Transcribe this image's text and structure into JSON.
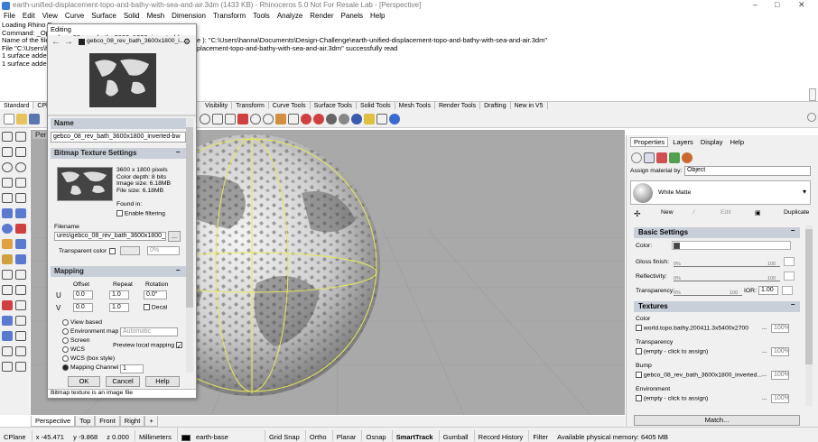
{
  "window": {
    "title": "earth-unified-displacement-topo-and-bathy-with-sea-and-air.3dm (1433 KB) - Rhinoceros 5.0 Not For Resale Lab - [Perspective]",
    "controls": [
      "–",
      "□",
      "✕"
    ]
  },
  "menu": [
    "File",
    "Edit",
    "View",
    "Curve",
    "Surface",
    "Solid",
    "Mesh",
    "Dimension",
    "Transform",
    "Tools",
    "Analyze",
    "Render",
    "Panels",
    "Help"
  ],
  "command_history": [
    "Loading Rhino R",
    "Command: _Op",
    "Name of the file",
    "File \"C:\\Users\\h",
    "1 surface added",
    "1 surface added"
  ],
  "command_history_right": [
    "e ): \"C:\\Users\\hanna\\Documents\\Design-Challenge\\earth-unified-displacement-topo-and-bathy-with-sea-and-air.3dm\"",
    "placement-topo-and-bathy-with-sea-and-air.3dm\" successfully read"
  ],
  "toolbar_tabs": [
    "Standard",
    "CPl",
    "Visibility",
    "Transform",
    "Curve Tools",
    "Surface Tools",
    "Solid Tools",
    "Mesh Tools",
    "Render Tools",
    "Drafting",
    "New in V5"
  ],
  "viewport_label": "Pers",
  "view_tabs": [
    "Perspective",
    "Top",
    "Front",
    "Right",
    "+"
  ],
  "dialog": {
    "title": "Editing gebco_08_rev_bath_3600x1800_inverted-bw",
    "path_text": "gebco_08_rev_bath_3600x1800_i...",
    "name_section": "Name",
    "name_value": "gebco_08_rev_bath_3600x1800_inverted-bw",
    "bitmap_section": "Bitmap Texture Settings",
    "bitmap_info": [
      "3600 x 1800 pixels",
      "Color depth: 8 bits",
      "Image size: 6.18MB",
      "File size: 6.18MB"
    ],
    "found_in": "Found in:",
    "enable_filtering": "Enable filtering",
    "filename_label": "Filename",
    "filename_value": "ures\\gebco_08_rev_bath_3600x1800_im",
    "browse": "...",
    "transparent_color": "Transparent color",
    "transparent_pct": "0%",
    "mapping_section": "Mapping",
    "mapping_headers": [
      "Offset",
      "Repeat",
      "Rotation"
    ],
    "u_label": "U",
    "v_label": "V",
    "u_offset": "0.0",
    "u_repeat": "1.0",
    "rotation": "0.0°",
    "v_offset": "0.0",
    "v_repeat": "1.0",
    "decal": "Decal",
    "radio_options": [
      "View based",
      "Environment map",
      "Screen",
      "WCS",
      "WCS (box style)",
      "Mapping Channel"
    ],
    "env_map_value": "Automatic",
    "preview_local": "Preview local mapping",
    "channel_value": "1",
    "ok": "OK",
    "cancel": "Cancel",
    "help": "Help",
    "footer": "Bitmap texture is an image file"
  },
  "right_panel": {
    "tabs": [
      "Properties",
      "Layers",
      "Display",
      "Help"
    ],
    "assign_label": "Assign material by:",
    "assign_value": "Object",
    "material_name": "White Matte",
    "actions": [
      "New",
      "Edit",
      "Duplicate"
    ],
    "basic_settings": "Basic Settings",
    "color_label": "Color:",
    "gloss_label": "Gloss finish:",
    "reflectivity_label": "Reflectivity:",
    "transparency_label": "Transparency:",
    "scale_min": "0%",
    "scale_max": "100",
    "ior_label": "IOR:",
    "ior_value": "1.00",
    "textures_section": "Textures",
    "tex_color_label": "Color",
    "tex_color_value": "world.topo.bathy.200411.3x5400x2700",
    "tex_transparency_label": "Transparency",
    "tex_transparency_value": "(empty - click to assign)",
    "tex_bump_label": "Bump",
    "tex_bump_value": "gebco_08_rev_bath_3600x1800_inverted...",
    "tex_env_label": "Environment",
    "tex_env_value": "(empty - click to assign)",
    "pct": "100%",
    "dots": "...",
    "match": "Match..."
  },
  "status": {
    "cplane": "CPlane",
    "x": "x -45.471",
    "y": "y -9.868",
    "z": "z 0.000",
    "units": "Millimeters",
    "layer": "earth-base",
    "toggles": [
      "Grid Snap",
      "Ortho",
      "Planar",
      "Osnap",
      "SmartTrack",
      "Gumball",
      "Record History",
      "Filter"
    ],
    "memory": "Available physical memory: 6405 MB"
  },
  "colors": {
    "panel_header": "#c8cfd8",
    "viewport_bg": "#a9a9a9",
    "gumball": "#e8e85a"
  }
}
